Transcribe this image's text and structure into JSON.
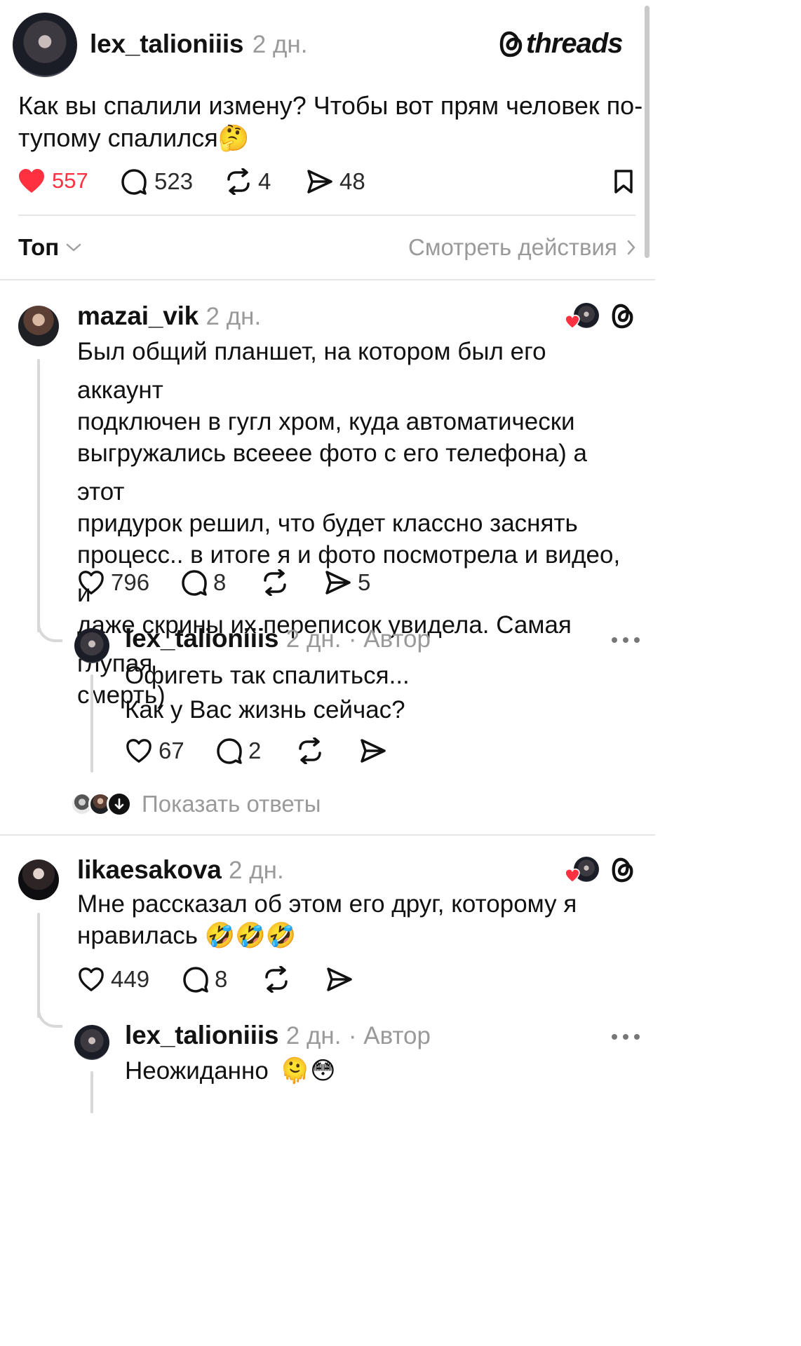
{
  "post": {
    "username": "lex_talioniiis",
    "time": "2 дн.",
    "brand": "threads",
    "text_line1": "Как вы спалили измену? Чтобы вот прям человек по-",
    "text_line2": "тупому спалился",
    "emoji": "🤔",
    "likes": "557",
    "comments": "523",
    "reposts": "4",
    "shares": "48"
  },
  "sort": {
    "label": "Топ",
    "activity_link": "Смотреть действия"
  },
  "comments": [
    {
      "username": "mazai_vik",
      "time": "2 дн.",
      "lines": [
        "Был общий планшет, на котором был его аккаунт",
        "подключен в гугл хром, куда автоматически",
        "выгружались всееее фото с его телефона) а этот",
        "придурок решил, что будет классно заснять",
        "процесс.. в итоге я и фото посмотрела и видео, и",
        "даже скрины их переписок увидела. Самая глупая",
        "смерть)"
      ],
      "likes": "796",
      "replies": "8",
      "shares": "5",
      "reply": {
        "username": "lex_talioniiis",
        "time": "2 дн.",
        "author_label": "· Автор",
        "line1": "Офигеть так спалиться...",
        "line2": "Как у Вас жизнь сейчас?",
        "likes": "67",
        "replies": "2"
      },
      "show_replies": "Показать ответы"
    },
    {
      "username": "likaesakova",
      "time": "2 дн.",
      "line1": "Мне рассказал об этом его друг, которому я",
      "line2": "нравилась",
      "emoji": "🤣🤣🤣",
      "likes": "449",
      "replies": "8",
      "reply": {
        "username": "lex_talioniiis",
        "time": "2 дн.",
        "author_label": "· Автор",
        "line1": "Неожиданно",
        "emoji": "🫠😳"
      }
    }
  ],
  "colors": {
    "like_red": "#ff3040",
    "muted": "#9a9a9a",
    "divider": "#e6e6e6"
  }
}
